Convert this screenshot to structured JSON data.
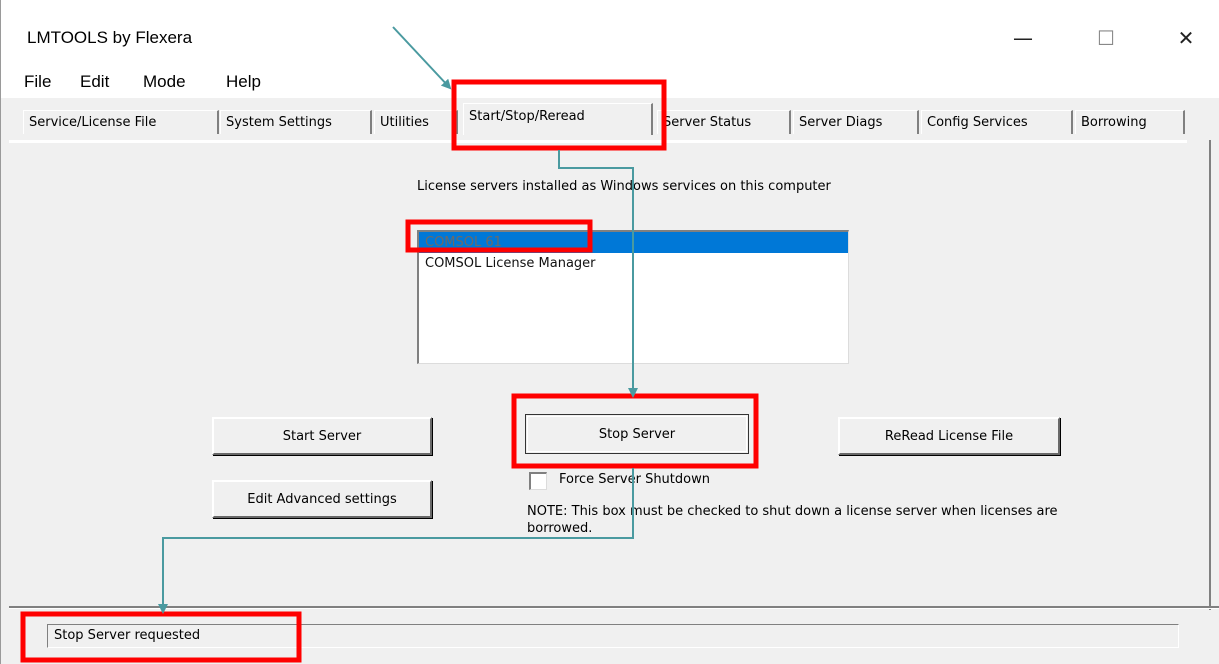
{
  "window": {
    "title": "LMTOOLS by Flexera",
    "controls": {
      "minimize": "—",
      "maximize": "☐",
      "close": "✕"
    }
  },
  "menu": [
    "File",
    "Edit",
    "Mode",
    "Help"
  ],
  "tabs": [
    "Service/License File",
    "System Settings",
    "Utilities",
    "Start/Stop/Reread",
    "Server Status",
    "Server Diags",
    "Config Services",
    "Borrowing"
  ],
  "active_tab": "Start/Stop/Reread",
  "services": {
    "label": "License servers installed as Windows services on this computer",
    "items": [
      "COMSOL 61",
      "COMSOL License Manager"
    ],
    "selected": "COMSOL 61"
  },
  "buttons": {
    "start": "Start Server",
    "stop": "Stop Server",
    "reread": "ReRead License File",
    "advanced": "Edit Advanced settings"
  },
  "force_shutdown": {
    "label": "Force Server Shutdown",
    "checked": false
  },
  "note": "NOTE:  This box must be checked to shut down a license server when licenses are borrowed.",
  "status": "Stop Server requested",
  "annotation_colors": {
    "highlight": "#ff0000",
    "arrow": "#4a9aa0"
  }
}
